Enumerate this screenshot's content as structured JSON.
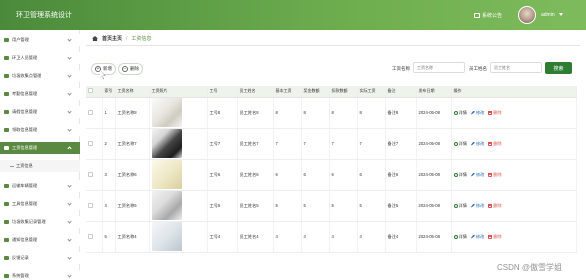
{
  "header": {
    "app_title": "环卫管理系统设计",
    "notice_label": "系统公告",
    "user_name": "admin"
  },
  "sidebar": {
    "items": [
      {
        "label": "用户管理",
        "top": 0
      },
      {
        "label": "环卫人员管理"
      },
      {
        "label": "垃圾收集点管理"
      },
      {
        "label": "考勤信息管理"
      },
      {
        "label": "请假信息管理"
      },
      {
        "label": "领取信息管理"
      },
      {
        "label": "工资信息管理",
        "active": true
      },
      {
        "label": "运输车辆管理"
      },
      {
        "label": "工具信息管理"
      },
      {
        "label": "垃圾收集记录管理"
      },
      {
        "label": "通知信息管理"
      },
      {
        "label": "反馈记录"
      },
      {
        "label": "系统管理"
      }
    ],
    "sub_items": [
      {
        "label": "工资信息"
      }
    ]
  },
  "breadcrumb": {
    "home": "首页主页",
    "separator": "/",
    "current": "工资信息"
  },
  "search": {
    "name_label": "工资名称",
    "name_placeholder": "工资名称",
    "staff_label": "员工姓名",
    "staff_placeholder": "员工姓名",
    "button_label": "搜索"
  },
  "toolbar": {
    "add_label": "新增",
    "delete_label": "删除"
  },
  "table": {
    "columns": [
      "",
      "索引",
      "工资名称",
      "工资照片",
      "工号",
      "员工姓名",
      "基本工资",
      "奖金数额",
      "扣款数额",
      "实际工资",
      "备注",
      "发布日期",
      "操作"
    ],
    "actions": {
      "detail": "详情",
      "edit": "修改",
      "delete": "删除"
    },
    "rows": [
      {
        "index": "1",
        "name": "工资名称8",
        "photo": "light",
        "job_no": "工号8",
        "staff": "员工姓名8",
        "base": "8",
        "bonus": "8",
        "deduct": "8",
        "actual": "8",
        "note": "备注8",
        "date": "2024-05-08"
      },
      {
        "index": "2",
        "name": "工资名称7",
        "photo": "dark",
        "job_no": "工号7",
        "staff": "员工姓名7",
        "base": "7",
        "bonus": "7",
        "deduct": "7",
        "actual": "7",
        "note": "备注7",
        "date": "2024-05-08"
      },
      {
        "index": "3",
        "name": "工资名称6",
        "photo": "cream",
        "job_no": "工号6",
        "staff": "员工姓名6",
        "base": "6",
        "bonus": "6",
        "deduct": "6",
        "actual": "6",
        "note": "备注6",
        "date": "2024-05-08"
      },
      {
        "index": "4",
        "name": "工资名称5",
        "photo": "grey",
        "job_no": "工号5",
        "staff": "员工姓名5",
        "base": "5",
        "bonus": "5",
        "deduct": "5",
        "actual": "5",
        "note": "备注5",
        "date": "2024-05-08"
      },
      {
        "index": "5",
        "name": "工资名称4",
        "photo": "blue",
        "job_no": "工号4",
        "staff": "员工姓名4",
        "base": "4",
        "bonus": "4",
        "deduct": "4",
        "actual": "4",
        "note": "备注4",
        "date": "2024-05-08"
      }
    ]
  },
  "watermark": "CSDN @傲雪学姐"
}
